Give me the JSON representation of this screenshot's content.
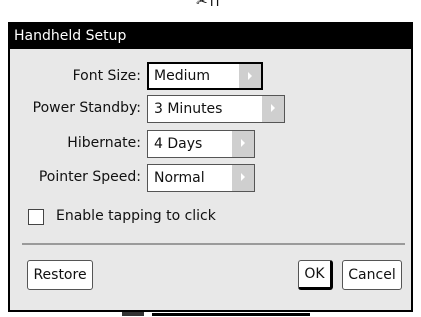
{
  "background": {
    "partial_glyph": "✂ii"
  },
  "dialog": {
    "title": "Handheld Setup",
    "fields": [
      {
        "label": "Font Size:",
        "value": "Medium",
        "focused": true
      },
      {
        "label": "Power Standby:",
        "value": "3 Minutes",
        "focused": false
      },
      {
        "label": "Hibernate:",
        "value": "4 Days",
        "focused": false
      },
      {
        "label": "Pointer Speed:",
        "value": "Normal",
        "focused": false
      }
    ],
    "checkbox": {
      "label": "Enable tapping to click",
      "checked": false
    },
    "buttons": {
      "restore": "Restore",
      "ok": "OK",
      "cancel": "Cancel"
    }
  },
  "colors": {
    "titlebar_bg": "#000000",
    "titlebar_text": "#ffffff",
    "dialog_bg": "#e8e8e8",
    "arrow_bg": "#cfcfcf"
  },
  "icons": {
    "dropdown_arrow": "chevron-right-icon"
  }
}
